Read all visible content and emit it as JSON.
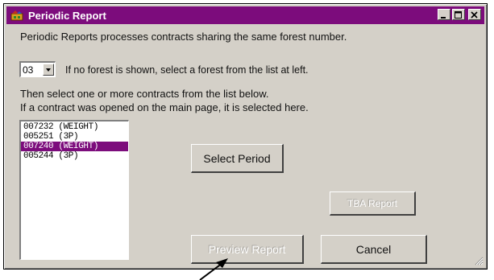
{
  "window": {
    "title": "Periodic Report",
    "titlebar_color": "#7c0c7c",
    "icons": [
      "app-icon",
      "minimize-icon",
      "maximize-icon",
      "close-icon"
    ]
  },
  "content": {
    "intro_text": "Periodic Reports processes contracts sharing the same forest number.",
    "forest_select_value": "03",
    "forest_hint": "If no forest is shown, select a forest from the list at left.",
    "instruction_line1": "Then select one or more contracts from the list below.",
    "instruction_line2": "If a contract was opened on the main page, it is selected here."
  },
  "contracts": [
    {
      "label": "007232 (WEIGHT)",
      "selected": false
    },
    {
      "label": "005251  (3P)",
      "selected": false
    },
    {
      "label": "007240  (WEIGHT)",
      "selected": true
    },
    {
      "label": "005244  (3P)",
      "selected": false
    }
  ],
  "buttons": {
    "select_period": "Select Period",
    "tba_report": "TBA Report",
    "preview_report": "Preview Report",
    "cancel": "Cancel"
  },
  "colors": {
    "accent": "#7c0c7c",
    "dialog_bg": "#d4d0c8"
  }
}
